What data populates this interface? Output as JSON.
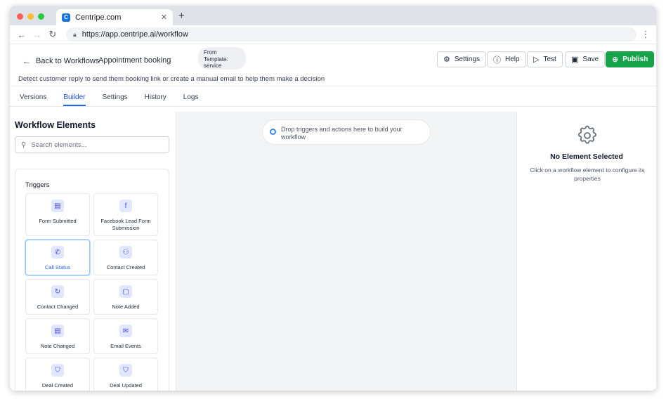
{
  "browser": {
    "tab_title": "Centripe.com",
    "favicon_letter": "C",
    "url": "https://app.centripe.ai/workflow"
  },
  "header": {
    "back_label": "Back to Workflows",
    "workflow_name": "Appointment booking",
    "template_line1": "From",
    "template_line2": "Template:",
    "template_line3": "service",
    "description": "Detect customer reply to send them booking link or create a manual email to help them make a decision",
    "buttons": {
      "settings": "Settings",
      "help": "Help",
      "test": "Test",
      "save": "Save",
      "publish": "Publish"
    }
  },
  "tabs": [
    {
      "label": "Versions",
      "active": false
    },
    {
      "label": "Builder",
      "active": true
    },
    {
      "label": "Settings",
      "active": false
    },
    {
      "label": "History",
      "active": false
    },
    {
      "label": "Logs",
      "active": false
    }
  ],
  "sidebar": {
    "title": "Workflow Elements",
    "search_placeholder": "Search elements...",
    "section_title": "Triggers",
    "elements": [
      {
        "label": "Form Submitted",
        "icon": "document-icon",
        "glyph": "▤"
      },
      {
        "label": "Facebook Lead Form Submission",
        "icon": "facebook-icon",
        "glyph": "f"
      },
      {
        "label": "Call Status",
        "icon": "phone-icon",
        "glyph": "✆",
        "selected": true
      },
      {
        "label": "Contact Created",
        "icon": "user-plus-icon",
        "glyph": "⚇"
      },
      {
        "label": "Contact Changed",
        "icon": "refresh-icon",
        "glyph": "↻"
      },
      {
        "label": "Note Added",
        "icon": "note-icon",
        "glyph": "▢"
      },
      {
        "label": "Note Changed",
        "icon": "document-icon",
        "glyph": "▤"
      },
      {
        "label": "Email Events",
        "icon": "mail-icon",
        "glyph": "✉"
      },
      {
        "label": "Deal Created",
        "icon": "handshake-icon",
        "glyph": "⛉"
      },
      {
        "label": "Deal Updated",
        "icon": "handshake-icon",
        "glyph": "⛉"
      }
    ]
  },
  "canvas": {
    "hint": "Drop triggers and actions here to build your workflow"
  },
  "properties": {
    "title": "No Element Selected",
    "subtitle": "Click on a workflow element to configure its properties"
  },
  "colors": {
    "accent": "#2563eb",
    "publish": "#16a34a",
    "canvas_bg": "#f3f4f6"
  }
}
